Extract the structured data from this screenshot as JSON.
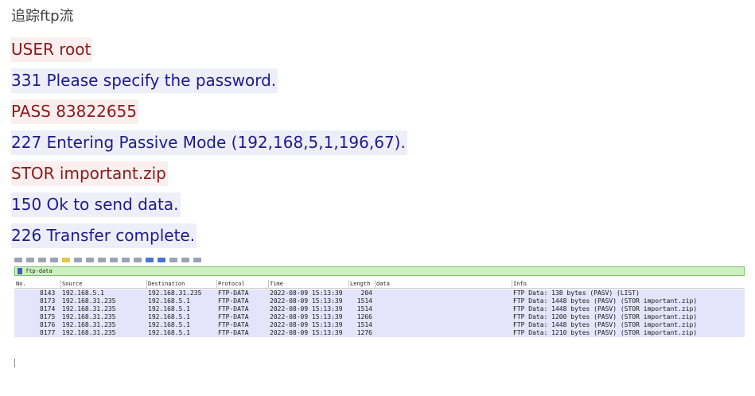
{
  "title": "追踪ftp流",
  "stream": [
    {
      "text": "USER root",
      "role": "client"
    },
    {
      "text": "331 Please specify the password.",
      "role": "server"
    },
    {
      "text": "PASS 83822655",
      "role": "client"
    },
    {
      "text": "227 Entering Passive Mode (192,168,5,1,196,67).",
      "role": "server"
    },
    {
      "text": "STOR important.zip",
      "role": "client"
    },
    {
      "text": "150 Ok to send data.",
      "role": "server"
    },
    {
      "text": "226 Transfer complete.",
      "role": "server"
    }
  ],
  "colors": {
    "client_bg": "#faeeee",
    "client_fg": "#8b1a1a",
    "server_bg": "#eeeef9",
    "server_fg": "#1c1c8e",
    "filter_bg": "#ccf0c0",
    "row_bg": "#e4e4fa"
  },
  "wireshark": {
    "filter": "ftp-data",
    "columns": [
      "No.",
      "Source",
      "Destination",
      "Protocol",
      "Time",
      "Length",
      "data",
      "Info"
    ],
    "rows": [
      {
        "no": "8143",
        "src": "192.168.5.1",
        "dst": "192.168.31.235",
        "proto": "FTP-DATA",
        "time": "2022-08-09 15:13:39",
        "len": "204",
        "info": "FTP Data: 138 bytes (PASV) (LIST)"
      },
      {
        "no": "8173",
        "src": "192.168.31.235",
        "dst": "192.168.5.1",
        "proto": "FTP-DATA",
        "time": "2022-08-09 15:13:39",
        "len": "1514",
        "info": "FTP Data: 1448 bytes (PASV) (STOR important.zip)"
      },
      {
        "no": "8174",
        "src": "192.168.31.235",
        "dst": "192.168.5.1",
        "proto": "FTP-DATA",
        "time": "2022-08-09 15:13:39",
        "len": "1514",
        "info": "FTP Data: 1448 bytes (PASV) (STOR important.zip)"
      },
      {
        "no": "8175",
        "src": "192.168.31.235",
        "dst": "192.168.5.1",
        "proto": "FTP-DATA",
        "time": "2022-08-09 15:13:39",
        "len": "1266",
        "info": "FTP Data: 1200 bytes (PASV) (STOR important.zip)"
      },
      {
        "no": "8176",
        "src": "192.168.31.235",
        "dst": "192.168.5.1",
        "proto": "FTP-DATA",
        "time": "2022-08-09 15:13:39",
        "len": "1514",
        "info": "FTP Data: 1448 bytes (PASV) (STOR important.zip)"
      },
      {
        "no": "8177",
        "src": "192.168.31.235",
        "dst": "192.168.5.1",
        "proto": "FTP-DATA",
        "time": "2022-08-09 15:13:39",
        "len": "1276",
        "info": "FTP Data: 1210 bytes (PASV) (STOR important.zip)"
      }
    ]
  }
}
